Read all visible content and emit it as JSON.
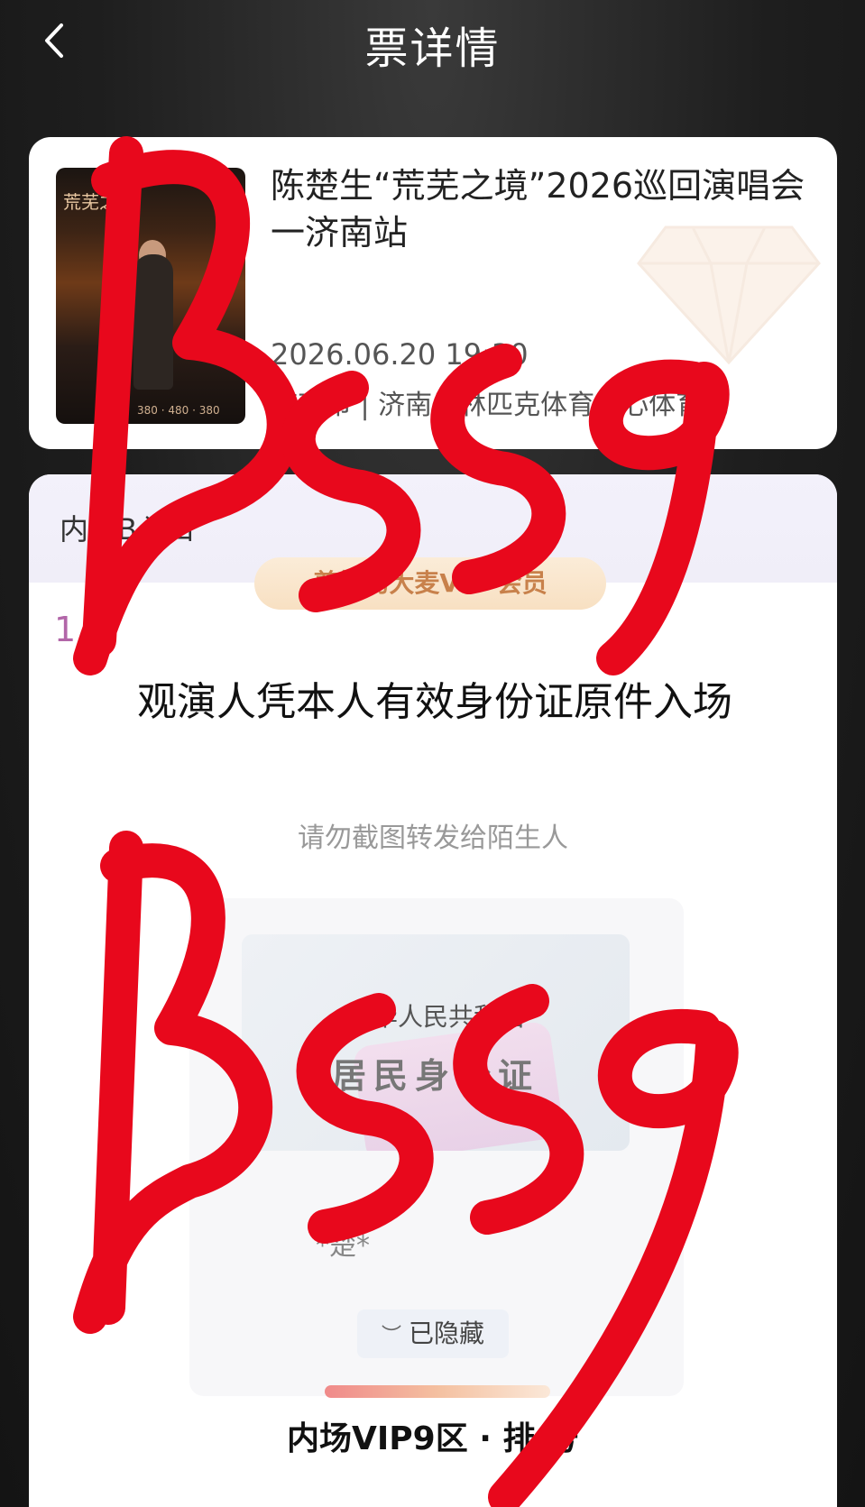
{
  "header": {
    "title": "票详情",
    "back_icon": "chevron-left-icon"
  },
  "event": {
    "name": "陈楚生“荒芜之境”2026巡回演唱会一济南站",
    "date": "2026.06.20 19:30",
    "venue": "济南市 | 济南奥林匹克体育中心体育场",
    "poster_title": "荒芜之境",
    "poster_prices": "380 · 480 · 380"
  },
  "ticket": {
    "entrance": "内场B入口",
    "vip_badge": "尊敬的大麦VIP·会员",
    "count": "1",
    "count_unit": "张",
    "notice": "观演人凭本人有效身份证原件入场",
    "warning": "请勿截图转发给陌生人",
    "id_country": "中华人民共和国",
    "id_type": "居民身份证",
    "holder_name": "*楚*",
    "hidden_label": "已隐藏",
    "seat": "内场VIP9区 · 排 号"
  },
  "overlay": {
    "watermark_text": "BSS9",
    "watermark_color": "#e8081c"
  }
}
